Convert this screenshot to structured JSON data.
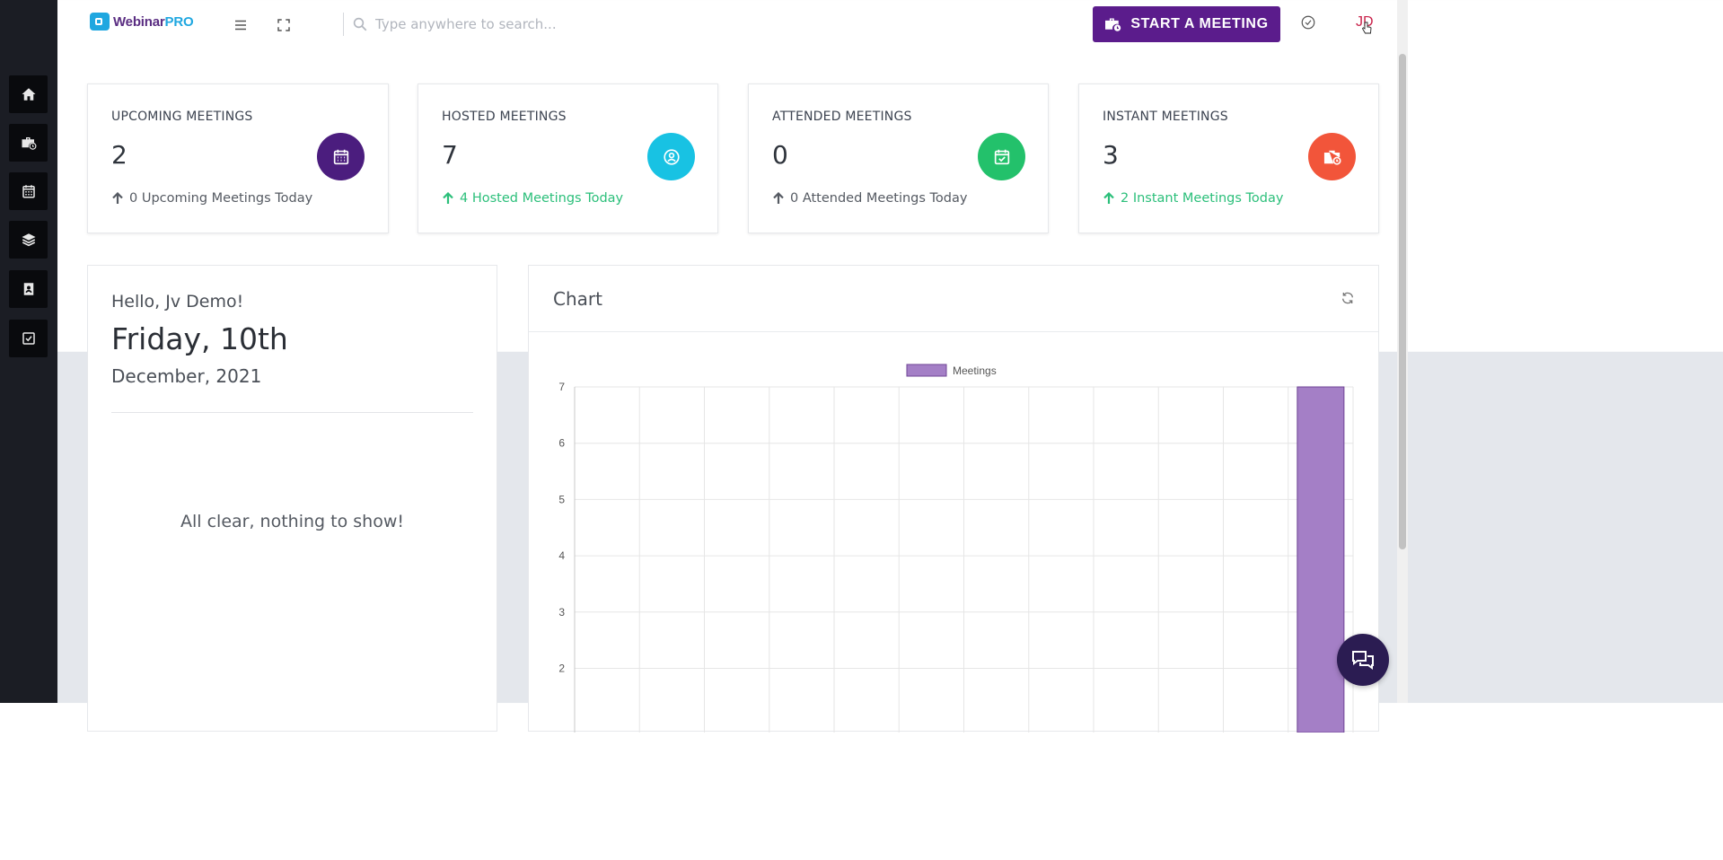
{
  "brand": {
    "name_main": "Webinar",
    "name_pro": "PRO"
  },
  "search": {
    "placeholder": "Type anywhere to search..."
  },
  "header": {
    "start_meeting_label": "START A MEETING",
    "avatar_initials": "JD"
  },
  "sidebar": {
    "items": [
      {
        "name": "home",
        "icon": "home-icon"
      },
      {
        "name": "instant-meetings",
        "icon": "briefcase-clock-icon"
      },
      {
        "name": "calendar",
        "icon": "calendar-icon"
      },
      {
        "name": "layers",
        "icon": "layers-icon"
      },
      {
        "name": "contacts",
        "icon": "contact-book-icon"
      },
      {
        "name": "tasks",
        "icon": "checkbox-icon"
      }
    ]
  },
  "stats": [
    {
      "title": "UPCOMING MEETINGS",
      "value": "2",
      "footer": "0 Upcoming Meetings Today",
      "color": "#4b1d7e",
      "footer_color": "#555a62",
      "icon": "calendar-icon"
    },
    {
      "title": "HOSTED MEETINGS",
      "value": "7",
      "footer": "4 Hosted Meetings Today",
      "color": "#18c2e3",
      "footer_color": "#2bbf7a",
      "icon": "user-circle-icon"
    },
    {
      "title": "ATTENDED MEETINGS",
      "value": "0",
      "footer": "0 Attended Meetings Today",
      "color": "#23c16b",
      "footer_color": "#555a62",
      "icon": "calendar-check-icon"
    },
    {
      "title": "INSTANT MEETINGS",
      "value": "3",
      "footer": "2 Instant Meetings Today",
      "color": "#f2553a",
      "footer_color": "#2bbf7a",
      "icon": "briefcase-clock-icon"
    }
  ],
  "greeting": {
    "hello": "Hello, Jv Demo!",
    "day": "Friday, 10th",
    "date": "December, 2021",
    "empty_message": "All clear, nothing to show!"
  },
  "chart_panel": {
    "title": "Chart"
  },
  "chart_data": {
    "type": "bar",
    "series": [
      {
        "name": "Meetings",
        "color": "#a47fc6",
        "border_color": "#6f4595"
      }
    ],
    "categories_count": 12,
    "values": [
      0,
      0,
      0,
      0,
      0,
      0,
      0,
      0,
      0,
      0,
      0,
      7
    ],
    "y_ticks_visible": [
      7,
      6,
      5,
      4,
      3,
      2
    ],
    "ylim": [
      0,
      7
    ],
    "grid": true,
    "legend": "top"
  }
}
